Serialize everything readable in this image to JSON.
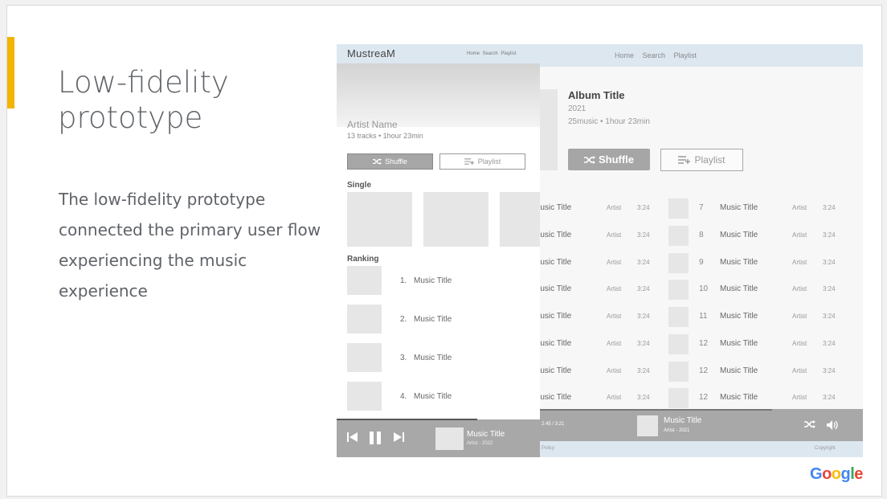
{
  "slide": {
    "title": "Low-fidelity prototype",
    "body": "The low-fidelity prototype connected the primary user flow experiencing  the music experience",
    "logo_text": "Google",
    "accent_color": "#f4b400"
  },
  "desktop": {
    "nav_links": "Home   Search   Playlist",
    "album": {
      "title": "Album Title",
      "year": "2021",
      "meta": "25music  •  1hour 23min",
      "shuffle_label": "Shuffle",
      "playlist_label": "Playlist"
    },
    "tracks_left": [
      {
        "title": "Music Title",
        "artist": "Artist",
        "duration": "3:24"
      },
      {
        "title": "Music Title",
        "artist": "Artist",
        "duration": "3:24"
      },
      {
        "title": "Music Title",
        "artist": "Artist",
        "duration": "3:24"
      },
      {
        "title": "Music Title",
        "artist": "Artist",
        "duration": "3:24"
      },
      {
        "title": "Music Title",
        "artist": "Artist",
        "duration": "3:24"
      },
      {
        "title": "Music Title",
        "artist": "Artist",
        "duration": "3:24"
      },
      {
        "title": "Music Title",
        "artist": "Artist",
        "duration": "3:24"
      },
      {
        "title": "Music Title",
        "artist": "Artist",
        "duration": "3:24"
      }
    ],
    "tracks_right": [
      {
        "num": "7",
        "title": "Music Title",
        "artist": "Artist",
        "duration": "3:24"
      },
      {
        "num": "8",
        "title": "Music Title",
        "artist": "Artist",
        "duration": "3:24"
      },
      {
        "num": "9",
        "title": "Music Title",
        "artist": "Artist",
        "duration": "3:24"
      },
      {
        "num": "10",
        "title": "Music Title",
        "artist": "Artist",
        "duration": "3:24"
      },
      {
        "num": "11",
        "title": "Music Title",
        "artist": "Artist",
        "duration": "3:24"
      },
      {
        "num": "12",
        "title": "Music Title",
        "artist": "Artist",
        "duration": "3:24"
      },
      {
        "num": "12",
        "title": "Music Title",
        "artist": "Artist",
        "duration": "3:24"
      },
      {
        "num": "12",
        "title": "Music Title",
        "artist": "Artist",
        "duration": "3:24"
      }
    ],
    "player": {
      "time": "2:45 / 3:21",
      "title": "Music Title",
      "artist": "Artist - 2021",
      "progress": 0.72
    },
    "footer": {
      "left": "Policy",
      "right": "Copyright"
    }
  },
  "mobile": {
    "logo": "MustreaM",
    "nav_links": "Home Search Playlist",
    "artist_name": "Artist Name",
    "meta": "13 tracks • 1hour 23min",
    "shuffle_label": "Shuffle",
    "playlist_label": "Playlist",
    "single_heading": "Single",
    "ranking_heading": "Ranking",
    "ranking": [
      {
        "num": "1.",
        "title": "Music Title"
      },
      {
        "num": "2.",
        "title": "Music Title"
      },
      {
        "num": "3.",
        "title": "Music Title"
      },
      {
        "num": "4.",
        "title": "Music Title"
      }
    ],
    "player": {
      "title": "Music Title",
      "artist": "Artist - 2022",
      "progress": 0.69
    }
  }
}
